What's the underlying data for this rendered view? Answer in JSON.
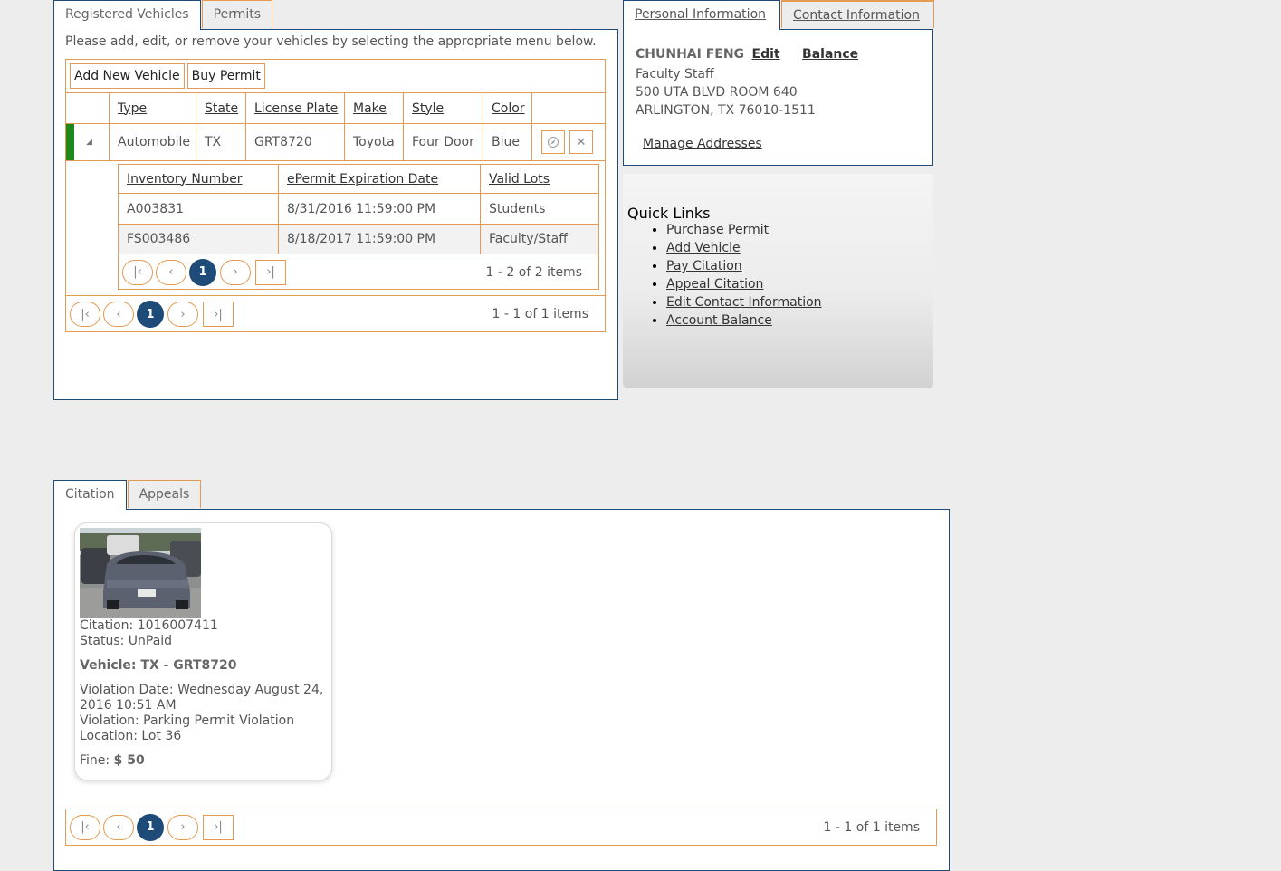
{
  "vehicles_tabs": [
    "Registered Vehicles",
    "Permits"
  ],
  "instructions": "Please add, edit, or remove your vehicles by selecting the appropriate menu below.",
  "toolbar": {
    "add_vehicle": "Add New Vehicle",
    "buy_permit": "Buy Permit"
  },
  "vehicle_columns": [
    "Type",
    "State",
    "License Plate",
    "Make",
    "Style",
    "Color"
  ],
  "vehicle": {
    "type": "Automobile",
    "state": "TX",
    "plate": "GRT8720",
    "make": "Toyota",
    "style": "Four Door",
    "color": "Blue"
  },
  "permit_columns": [
    "Inventory Number",
    "ePermit Expiration Date",
    "Valid Lots"
  ],
  "permits": [
    {
      "inventory": "A003831",
      "expiration": "8/31/2016 11:59:00 PM",
      "lots": "Students"
    },
    {
      "inventory": "FS003486",
      "expiration": "8/18/2017 11:59:00 PM",
      "lots": "Faculty/Staff"
    }
  ],
  "permit_pager": {
    "page": "1",
    "info": "1 - 2 of 2 items"
  },
  "vehicle_pager": {
    "page": "1",
    "info": "1 - 1 of 1 items"
  },
  "info_tabs": [
    "Personal Information",
    "Contact Information"
  ],
  "person": {
    "name": "CHUNHAI FENG",
    "edit": "Edit",
    "balance": "Balance",
    "role": "Faculty Staff",
    "address1": "500 UTA BLVD ROOM 640",
    "address2": "ARLINGTON, TX 76010-1511",
    "manage": "Manage Addresses"
  },
  "quick_links": {
    "title": "Quick Links",
    "items": [
      "Purchase Permit",
      "Add Vehicle",
      "Pay Citation",
      "Appeal Citation",
      "Edit Contact Information",
      "Account Balance"
    ]
  },
  "citation_tabs": [
    "Citation",
    "Appeals"
  ],
  "citation": {
    "number": "Citation: 1016007411",
    "status": "Status: UnPaid",
    "vehicle": "Vehicle: TX - GRT8720",
    "date_line1": "Violation Date: Wednesday August 24,",
    "date_line2": "2016 10:51 AM",
    "violation": "Violation: Parking Permit Violation",
    "location": "Location: Lot 36",
    "fine_label": "Fine:",
    "fine_value": "$ 50"
  },
  "citation_pager": {
    "page": "1",
    "info": "1 - 1 of 1 items"
  },
  "colors": {
    "accent": "#e49a52",
    "navy": "#1f4b78",
    "status_bar": "#1a8a1a"
  }
}
